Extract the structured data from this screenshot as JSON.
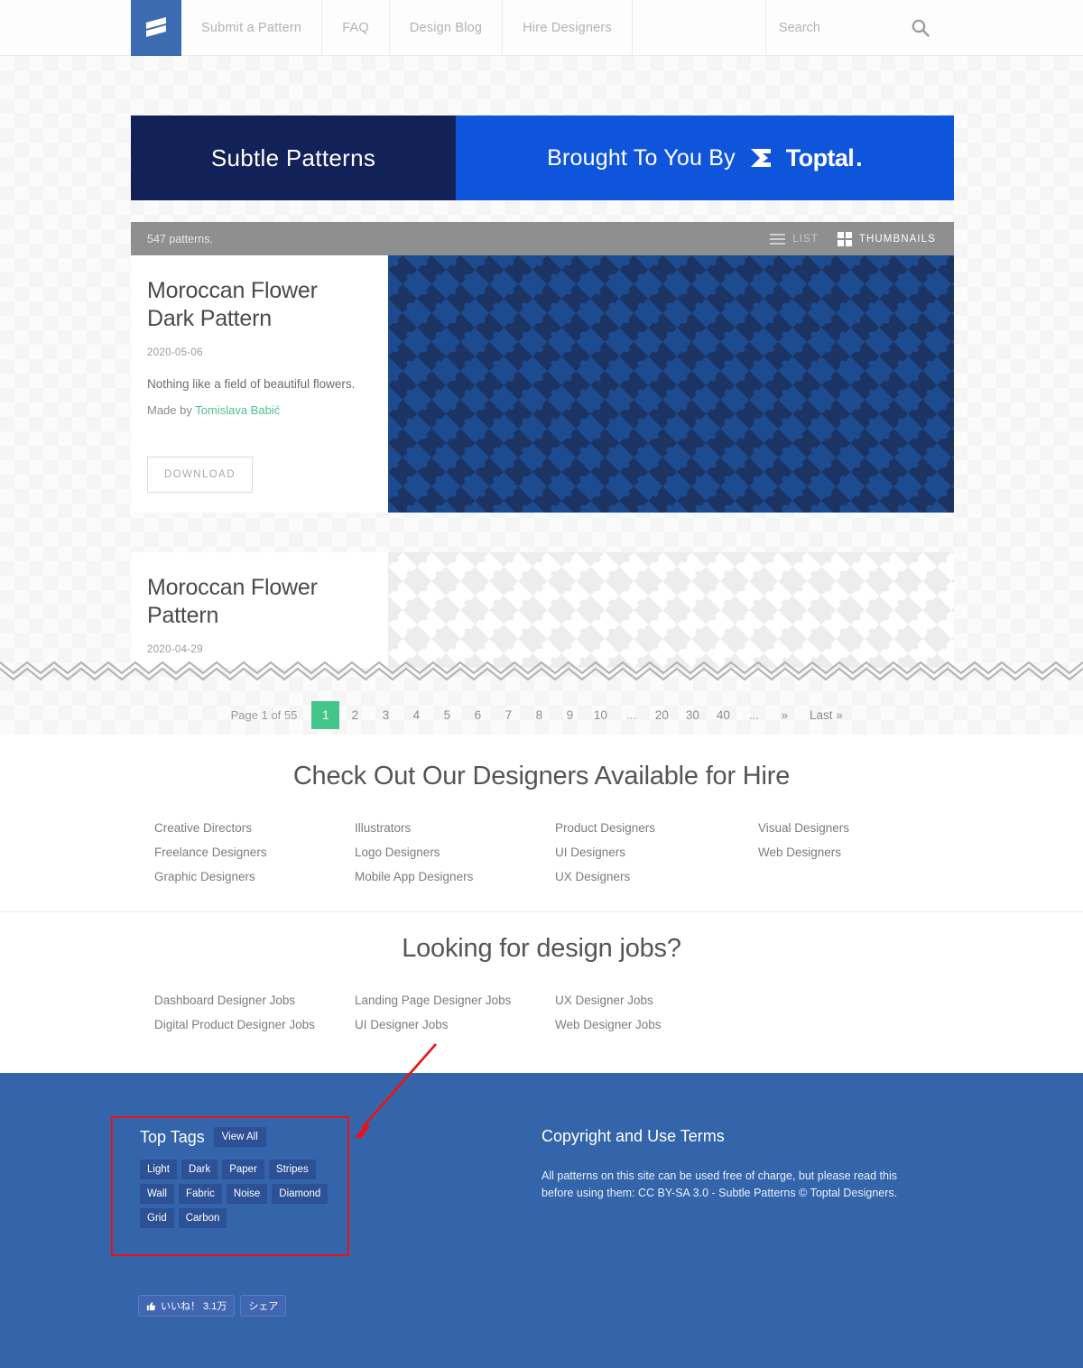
{
  "nav": {
    "logo_icon": "subtle-patterns-logo",
    "items": [
      {
        "label": "Submit a Pattern"
      },
      {
        "label": "FAQ"
      },
      {
        "label": "Design Blog"
      },
      {
        "label": "Hire Designers"
      }
    ],
    "search": {
      "placeholder": "Search",
      "value": "",
      "icon": "search-icon"
    }
  },
  "banner": {
    "left_text": "Subtle Patterns",
    "right_text": "Brought To You By",
    "brand": "Toptal",
    "left_bg": "#122259",
    "right_bg": "#0f55dc"
  },
  "toolbar": {
    "count_text": "547 patterns.",
    "list_label": "LIST",
    "thumbnails_label": "THUMBNAILS",
    "active_view": "THUMBNAILS",
    "bg": "#8f8f8f"
  },
  "patterns": [
    {
      "title": "Moroccan Flower Dark Pattern",
      "date": "2020-05-06",
      "description": "Nothing like a field of beautiful flowers.",
      "made_by_prefix": "Made by",
      "author": "Tomislava Babić",
      "download_label": "DOWNLOAD",
      "swatch_bg": "#1b3464",
      "swatch_fg": "#1d4b8f"
    },
    {
      "title": "Moroccan Flower Pattern",
      "date": "2020-04-29",
      "swatch_bg": "#ffffff",
      "swatch_fg": "#ededed"
    }
  ],
  "pagination": {
    "page_of": "Page 1 of 55",
    "current": "1",
    "items": [
      "1",
      "2",
      "3",
      "4",
      "5",
      "6",
      "7",
      "8",
      "9",
      "10",
      "...",
      "20",
      "30",
      "40",
      "...",
      "»",
      "Last »"
    ],
    "active_color": "#44c58a"
  },
  "hire_section": {
    "title": "Check Out Our Designers Available for Hire",
    "links": [
      "Creative Directors",
      "Illustrators",
      "Product Designers",
      "Visual Designers",
      "Freelance Designers",
      "Logo Designers",
      "UI Designers",
      "Web Designers",
      "Graphic Designers",
      "Mobile App Designers",
      "UX Designers",
      ""
    ]
  },
  "jobs_section": {
    "title": "Looking for design jobs?",
    "links": [
      "Dashboard Designer Jobs",
      "Landing Page Designer Jobs",
      "UX Designer Jobs",
      "Digital Product Designer Jobs",
      "UI Designer Jobs",
      "Web Designer Jobs"
    ]
  },
  "footer": {
    "bg": "#3465ab",
    "tags_title": "Top Tags",
    "view_all_label": "View All",
    "tags": [
      "Light",
      "Dark",
      "Paper",
      "Stripes",
      "Wall",
      "Fabric",
      "Noise",
      "Diamond",
      "Grid",
      "Carbon"
    ],
    "copyright_title": "Copyright and Use Terms",
    "copyright_body": "All patterns on this site can be used free of charge, but please read this before using them: CC BY-SA 3.0 - Subtle Patterns © Toptal Designers.",
    "facebook": {
      "like_label": "いいね！ 3.1万",
      "share_label": "シェア",
      "thumb_icon": "thumbs-up-icon"
    }
  },
  "annotation": {
    "color": "#ee1111",
    "box_target": "top-tags",
    "arrow": "points-to-top-tags"
  }
}
